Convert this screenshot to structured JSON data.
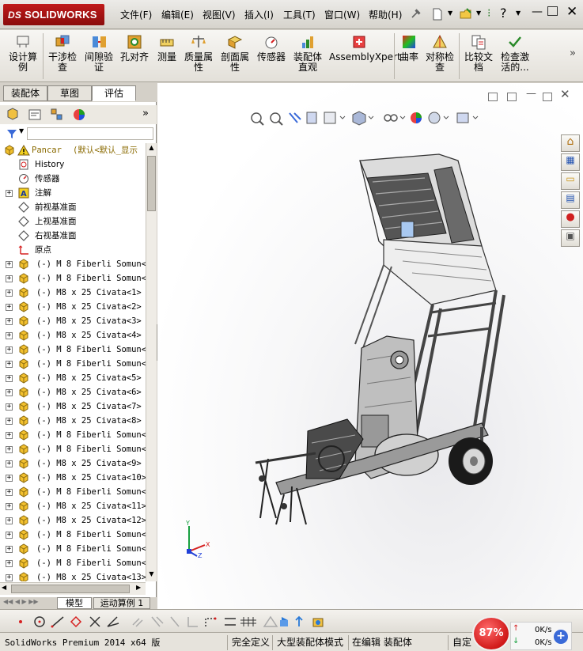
{
  "brand": {
    "logo_text": "SOLIDWORKS",
    "logo_prefix": "DS"
  },
  "menu": [
    "文件(F)",
    "编辑(E)",
    "视图(V)",
    "插入(I)",
    "工具(T)",
    "窗口(W)",
    "帮助(H)"
  ],
  "commands": [
    {
      "label": "设计算例",
      "icon": "study-icon"
    },
    {
      "label": "干涉检查",
      "icon": "interference-icon"
    },
    {
      "label": "间隙验证",
      "icon": "clearance-icon"
    },
    {
      "label": "孔对齐",
      "icon": "hole-align-icon"
    },
    {
      "label": "测量",
      "icon": "measure-icon"
    },
    {
      "label": "质量属性",
      "icon": "mass-icon"
    },
    {
      "label": "剖面属性",
      "icon": "section-icon"
    },
    {
      "label": "传感器",
      "icon": "sensor-icon"
    },
    {
      "label": "装配体直观",
      "icon": "visualization-icon"
    },
    {
      "label": "AssemblyXpert",
      "icon": "xpert-icon"
    },
    {
      "label": "曲率",
      "icon": "curvature-icon"
    },
    {
      "label": "对称检查",
      "icon": "symmetry-icon"
    },
    {
      "label": "比较文档",
      "icon": "compare-icon"
    },
    {
      "label": "检查激活的...",
      "icon": "check-icon"
    }
  ],
  "left_tabs": [
    "装配体",
    "草图",
    "评估"
  ],
  "tree": {
    "root_label": "Pancar",
    "root_config": "(默认<默认_显示",
    "features": [
      {
        "label": "History",
        "icon": "history-icon"
      },
      {
        "label": "传感器",
        "icon": "sensor-icon"
      },
      {
        "label": "注解",
        "icon": "annotation-icon"
      },
      {
        "label": "前视基准面",
        "icon": "plane-icon"
      },
      {
        "label": "上视基准面",
        "icon": "plane-icon"
      },
      {
        "label": "右视基准面",
        "icon": "plane-icon"
      },
      {
        "label": "原点",
        "icon": "origin-icon"
      }
    ],
    "components": [
      "(-) M 8 Fiberli Somun<1",
      "(-) M 8 Fiberli Somun<2",
      "(-) M8 x 25 Civata<1> (",
      "(-) M8 x 25 Civata<2> (",
      "(-) M8 x 25 Civata<3> (",
      "(-) M8 x 25 Civata<4> (",
      "(-) M 8 Fiberli Somun<3",
      "(-) M 8 Fiberli Somun<4",
      "(-) M8 x 25 Civata<5> (",
      "(-) M8 x 25 Civata<6> (",
      "(-) M8 x 25 Civata<7> (",
      "(-) M8 x 25 Civata<8> (",
      "(-) M 8 Fiberli Somun<5",
      "(-) M 8 Fiberli Somun<6",
      "(-) M8 x 25 Civata<9> (",
      "(-) M8 x 25 Civata<10>",
      "(-) M 8 Fiberli Somun<7",
      "(-) M8 x 25 Civata<11>",
      "(-) M8 x 25 Civata<12>",
      "(-) M 8 Fiberli Somun<8",
      "(-) M 8 Fiberli Somun<9",
      "(-) M 8 Fiberli Somun<1",
      "(-) M8 x 25 Civata<13>"
    ]
  },
  "bottom_tabs": [
    "模型",
    "运动算例 1"
  ],
  "status": {
    "product": "SolidWorks Premium 2014 x64 版",
    "definition": "完全定义",
    "mode": "大型装配体模式",
    "editing": "在编辑 装配体",
    "custom": "自定"
  },
  "network": {
    "percent": "87%",
    "up": "0K/s",
    "down": "0K/s"
  },
  "colors": {
    "accent_red": "#c01a1a",
    "tree_gold": "#d4a017",
    "selection_blue": "#316ac5"
  }
}
